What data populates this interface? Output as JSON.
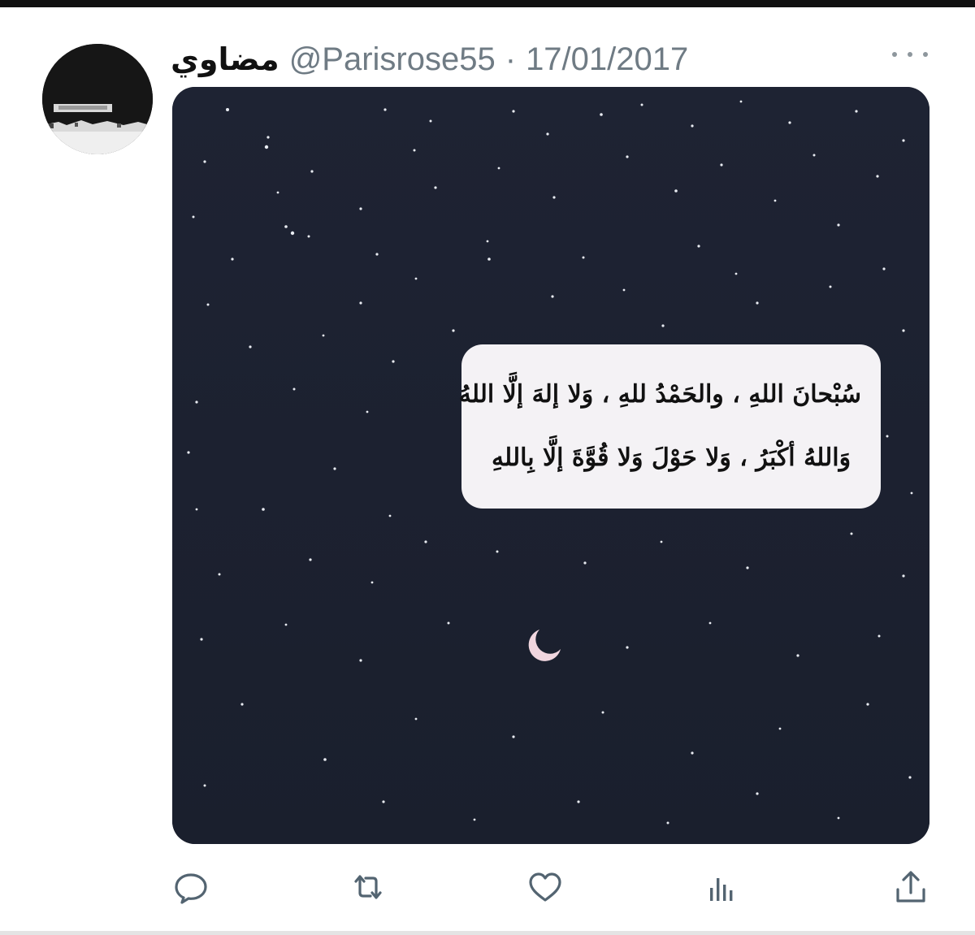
{
  "tweet": {
    "display_name": "مضاوي",
    "handle": "@Parisrose55",
    "separator": "·",
    "date": "17/01/2017",
    "more_icon": "more-dots-icon",
    "media": {
      "quote_lines": [
        "سُبْحانَ اللهِ ، والحَمْدُ للهِ ، وَلا إلهَ إلَّا اللهُ",
        "وَاللهُ أكْبَرُ ، وَلا حَوْلَ وَلا قُوَّةَ إلَّا بِاللهِ"
      ]
    },
    "actions": [
      {
        "icon": "reply-icon"
      },
      {
        "icon": "retweet-icon"
      },
      {
        "icon": "like-icon"
      },
      {
        "icon": "analytics-icon"
      },
      {
        "icon": "share-icon"
      }
    ]
  },
  "colors": {
    "sky": "#1b2130",
    "card": "#f4f2f5",
    "muted_text": "#6f7b84",
    "icon": "#536471"
  }
}
